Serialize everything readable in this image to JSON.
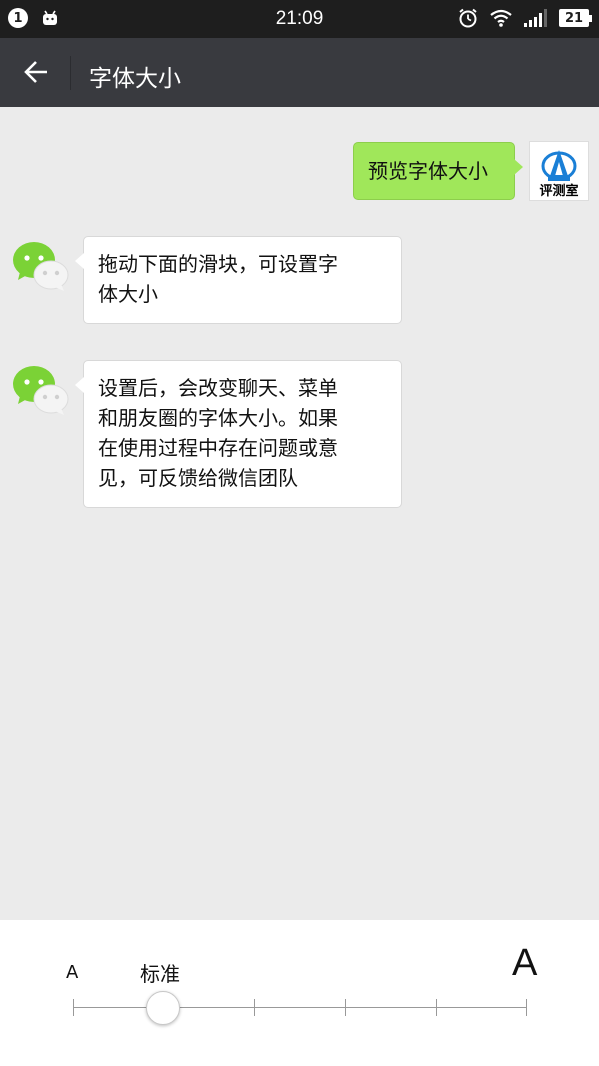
{
  "status_bar": {
    "notification_count": "1",
    "time": "21:09",
    "battery": "21",
    "icons": [
      "notification-badge",
      "android-icon",
      "alarm-icon",
      "wifi-icon",
      "signal-icon",
      "battery-icon"
    ]
  },
  "title_bar": {
    "back_icon": "arrow-left-icon",
    "title": "字体大小"
  },
  "chat": {
    "messages": [
      {
        "side": "right",
        "text": "预览字体大小",
        "avatar": "app-review-avatar"
      },
      {
        "side": "left",
        "text_lines": [
          "拖动下面的滑块，可设置字",
          "体大小"
        ],
        "avatar": "wechat-avatar"
      },
      {
        "side": "left",
        "text_lines": [
          "设置后，会改变聊天、菜单",
          "和朋友圈的字体大小。如果",
          "在使用过程中存在问题或意",
          "见，可反馈给微信团队"
        ],
        "avatar": "wechat-avatar"
      }
    ],
    "app_avatar_text": "评测室",
    "app_avatar_logo": "APP"
  },
  "font_slider": {
    "small_label": "A",
    "current_label": "标准",
    "large_label": "A",
    "levels": 6,
    "selected_index": 1
  },
  "colors": {
    "status_bar_bg": "#1e1e1e",
    "title_bar_bg": "#393a3f",
    "chat_bg": "#ebebeb",
    "outgoing_bubble": "#a0e75a",
    "incoming_bubble": "#ffffff",
    "wechat_green": "#7bd236"
  }
}
